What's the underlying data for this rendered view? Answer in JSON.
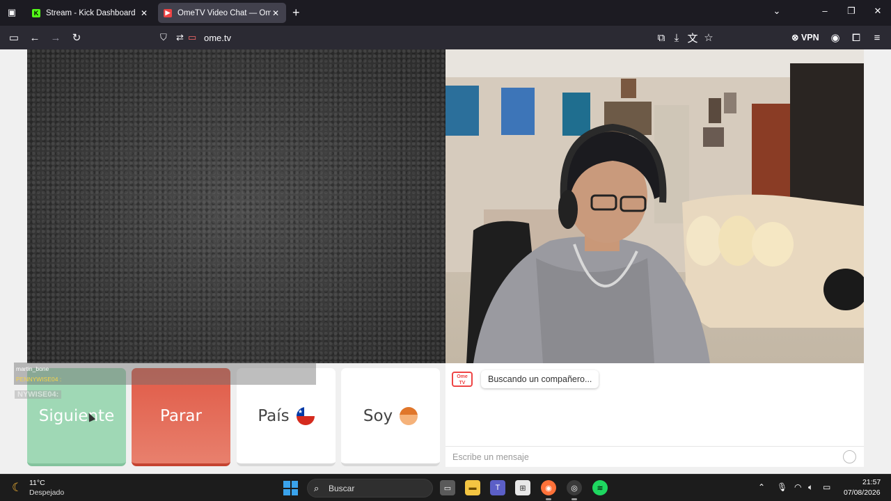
{
  "browser": {
    "tabs": [
      {
        "title": "Stream - Kick Dashboard",
        "favicon": "kick-icon",
        "active": false
      },
      {
        "title": "OmeTV Video Chat — Omegle Alternative",
        "favicon": "ometv-icon",
        "active": true
      }
    ],
    "url": "ome.tv",
    "vpn_label": "VPN",
    "accent": "#42414d"
  },
  "stream_overlay": {
    "line1": "martin_bone",
    "line2": "PENNYWISE04 :",
    "line3": "NYWISE04:"
  },
  "controls": {
    "next_label": "Siguiente",
    "stop_label": "Parar",
    "country_label": "País",
    "country_flag": "chile-flag-icon",
    "gender_label": "Soy",
    "gender_icon": "boy-face-icon"
  },
  "chat": {
    "logo_text": "Ome TV",
    "status": "Buscando un compañero...",
    "input_placeholder": "Escribe un mensaje"
  },
  "colors": {
    "next": "#9fd8b5",
    "stop": "#e05a47",
    "panel": "#ffffff"
  },
  "taskbar": {
    "weather_temp": "11°C",
    "weather_cond": "Despejado",
    "search_placeholder": "Buscar",
    "time": "21:57",
    "date": "07/08/2026"
  }
}
